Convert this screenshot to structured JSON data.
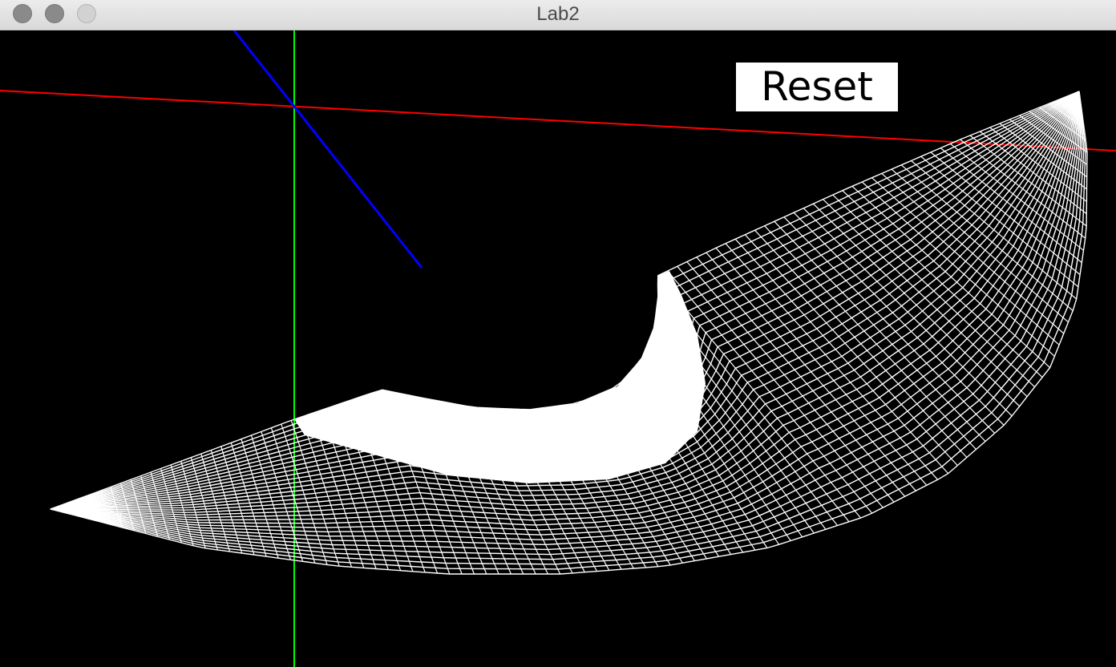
{
  "window": {
    "title": "Lab2"
  },
  "toolbar": {
    "reset_label": "Reset"
  },
  "scene": {
    "background_color": "#000000",
    "axes": [
      {
        "name": "x",
        "color": "#ff0000"
      },
      {
        "name": "y",
        "color": "#00ff00"
      },
      {
        "name": "z",
        "color": "#0000ff"
      }
    ],
    "mesh": {
      "type": "wireframe surface",
      "color": "#ffffff"
    }
  }
}
